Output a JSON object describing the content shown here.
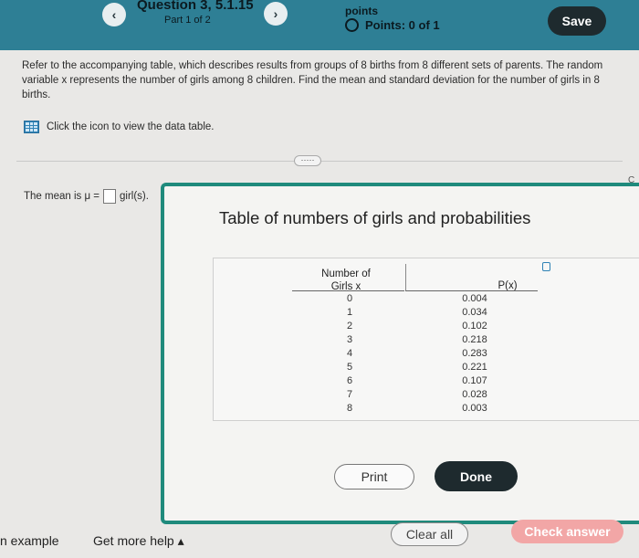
{
  "header": {
    "question_title": "Question 3, 5.1.15",
    "part": "Part 1 of 2",
    "points_label": "points",
    "points_value": "Points: 0 of 1",
    "save_label": "Save",
    "prev_symbol": "‹",
    "next_symbol": "›"
  },
  "question": {
    "text": "Refer to the accompanying table, which describes results from groups of 8 births from 8 different sets of parents. The random variable x represents the number of girls among 8 children. Find the mean and standard deviation for the number of girls in 8 births.",
    "table_link": "Click the icon to view the data table.",
    "more_label": "·····",
    "answer_prefix": "The mean is μ =",
    "answer_suffix": "girl(s).",
    "side_letter": "C"
  },
  "popup": {
    "title": "Table of numbers of girls and probabilities",
    "col1_header": "Number of Girls x",
    "col2_header": "P(x)",
    "rows": [
      {
        "x": "0",
        "p": "0.004"
      },
      {
        "x": "1",
        "p": "0.034"
      },
      {
        "x": "2",
        "p": "0.102"
      },
      {
        "x": "3",
        "p": "0.218"
      },
      {
        "x": "4",
        "p": "0.283"
      },
      {
        "x": "5",
        "p": "0.221"
      },
      {
        "x": "6",
        "p": "0.107"
      },
      {
        "x": "7",
        "p": "0.028"
      },
      {
        "x": "8",
        "p": "0.003"
      }
    ],
    "print_label": "Print",
    "done_label": "Done"
  },
  "footer": {
    "example_label": "n example",
    "more_help_label": "Get more help ▴",
    "clear_label": "Clear all",
    "check_label": "Check answer"
  },
  "colors": {
    "header_bg": "#2e7f95",
    "popup_border": "#1f8a7c",
    "check_button": "#f2a6a6",
    "dark_button": "#1e2a2e"
  }
}
